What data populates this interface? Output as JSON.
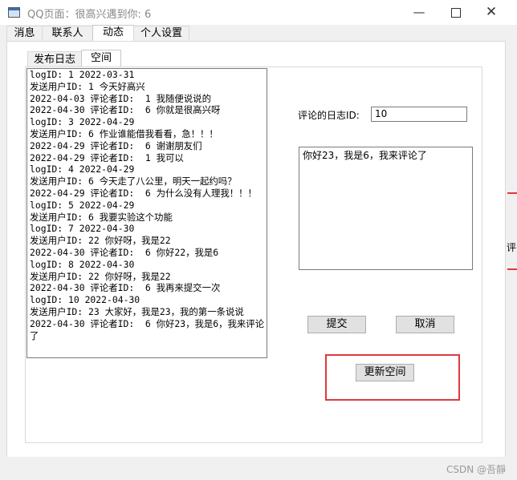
{
  "window": {
    "title": "QQ页面：很高兴遇到你: 6",
    "minimize_glyph": "—",
    "close_glyph": "✕"
  },
  "main_tabs": [
    "消息",
    "联系人",
    "动态",
    "个人设置"
  ],
  "sub_tabs": [
    "发布日志",
    "空间"
  ],
  "log_lines": [
    "logID: 1 2022-03-31",
    "发送用户ID: 1 今天好高兴",
    "2022-04-03 评论者ID:  1 我随便说说的",
    "2022-04-30 评论者ID:  6 你就是很高兴呀",
    "logID: 3 2022-04-29",
    "发送用户ID: 6 作业谁能借我看看，急！！！",
    "2022-04-29 评论者ID:  6 谢谢朋友们",
    "2022-04-29 评论者ID:  1 我可以",
    "logID: 4 2022-04-29",
    "发送用户ID: 6 今天走了八公里，明天一起约吗？",
    "2022-04-29 评论者ID:  6 为什么没有人理我！！！",
    "logID: 5 2022-04-29",
    "发送用户ID: 6 我要实验这个功能",
    "logID: 7 2022-04-30",
    "发送用户ID: 22 你好呀，我是22",
    "2022-04-30 评论者ID:  6 你好22，我是6",
    "logID: 8 2022-04-30",
    "发送用户ID: 22 你好呀，我是22",
    "2022-04-30 评论者ID:  6 我再来提交一次",
    "logID: 10 2022-04-30",
    "发送用户ID: 23 大家好，我是23，我的第一条说说",
    "2022-04-30 评论者ID:  6 你好23，我是6，我来评论了"
  ],
  "form": {
    "log_id_label": "评论的日志ID:",
    "log_id_value": "10",
    "comment_text": "你好23，我是6，我来评论了"
  },
  "buttons": {
    "submit": "提交",
    "cancel": "取消",
    "refresh": "更新空间"
  },
  "background_edge_text": "评",
  "watermark": "CSDN @吾靜"
}
